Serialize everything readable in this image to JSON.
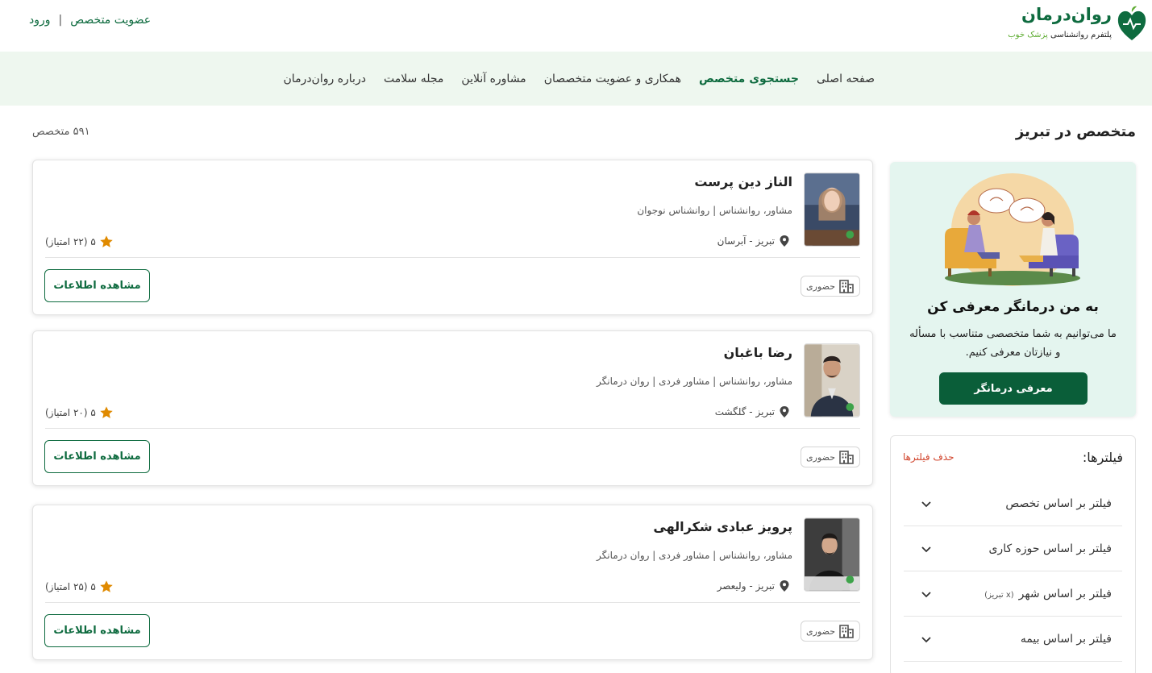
{
  "header": {
    "brand_name": "روان‌درمان",
    "brand_tagline_part1": "پلتفرم روانشناسی",
    "brand_tagline_part2": "پزشک خوب",
    "expert_signup": "عضویت متخصص",
    "separator": "|",
    "login": "ورود"
  },
  "nav": {
    "items": [
      {
        "label": "صفحه اصلی"
      },
      {
        "label": "جستجوی متخصص"
      },
      {
        "label": "همکاری و عضویت متخصصان"
      },
      {
        "label": "مشاوره آنلاین"
      },
      {
        "label": "مجله سلامت"
      },
      {
        "label": "درباره روان‌درمان"
      }
    ],
    "active_index": 1
  },
  "page": {
    "title": "متخصص در تبریز",
    "count": "۵۹۱ متخصص"
  },
  "experts": [
    {
      "name": "الناز دین پرست",
      "roles": "مشاور، روانشناس | روانشناس نوجوان",
      "location": "تبریز - آبرسان",
      "rating": "۵ (۲۲ امتیاز)",
      "visit_type": "حضوری",
      "view_label": "مشاهده اطلاعات"
    },
    {
      "name": "رضا باغبان",
      "roles": "مشاور، روانشناس | مشاور فردی | روان درمانگر",
      "location": "تبریز - گلگشت",
      "rating": "۵ (۲۰ امتیاز)",
      "visit_type": "حضوری",
      "view_label": "مشاهده اطلاعات"
    },
    {
      "name": "پرویز عبادی شکرالهی",
      "roles": "مشاور، روانشناس | مشاور فردی | روان درمانگر",
      "location": "تبریز - ولیعصر",
      "rating": "۵ (۲۵ امتیاز)",
      "visit_type": "حضوری",
      "view_label": "مشاهده اطلاعات"
    }
  ],
  "promo": {
    "title": "به من درمانگر معرفی کن",
    "text": "ما می‌توانیم به شما متخصصی متناسب با مسأله و نیازتان معرفی کنیم.",
    "button": "معرفی درمانگر"
  },
  "filters": {
    "title": "فیلترها:",
    "clear": "حذف فیلترها",
    "items": [
      {
        "label": "فیلتر بر اساس تخصص",
        "chip": ""
      },
      {
        "label": "فیلتر بر اساس حوزه کاری",
        "chip": ""
      },
      {
        "label": "فیلتر بر اساس شهر",
        "chip": "(x تبریز)"
      },
      {
        "label": "فیلتر بر اساس بیمه",
        "chip": ""
      }
    ]
  },
  "colors": {
    "brand_green": "#0e6b3f",
    "nav_bg": "#eef7ef",
    "promo_bg": "#e4f5ef",
    "star": "#e08a00",
    "clear_red": "#d1452d"
  }
}
